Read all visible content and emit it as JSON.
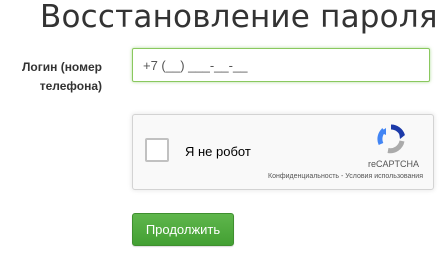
{
  "page": {
    "title": "Восстановление пароля"
  },
  "form": {
    "login_label_line1": "Логин (номер",
    "login_label_line2": "телефона)",
    "login_value": "+7 (__) ___-__-__",
    "submit_label": "Продолжить"
  },
  "recaptcha": {
    "checkbox_label": "Я не робот",
    "brand": "reCAPTCHA",
    "privacy_link": "Конфиденциальность",
    "separator": " - ",
    "terms_link": "Условия использования"
  },
  "colors": {
    "input_focus_border": "#8ac85e",
    "button_green": "#4aa63a",
    "recaptcha_blue": "#1c3aa9",
    "recaptcha_light_blue": "#4285f4",
    "recaptcha_gray": "#ababab"
  }
}
